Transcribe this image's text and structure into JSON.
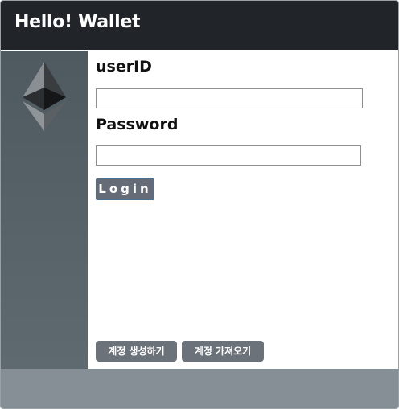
{
  "header": {
    "title": "Hello! Wallet"
  },
  "form": {
    "userid_label": "userID",
    "userid_value": "",
    "password_label": "Password",
    "password_value": "",
    "login_label": "Login"
  },
  "actions": {
    "create_account_label": "계정 생성하기",
    "import_account_label": "계정 가져오기"
  },
  "icons": {
    "sidebar_logo": "ethereum-icon"
  },
  "colors": {
    "header_bg": "#212529",
    "sidebar_bg": "#56626a",
    "footer_bg": "#868e96",
    "button_bg": "#666c77"
  }
}
